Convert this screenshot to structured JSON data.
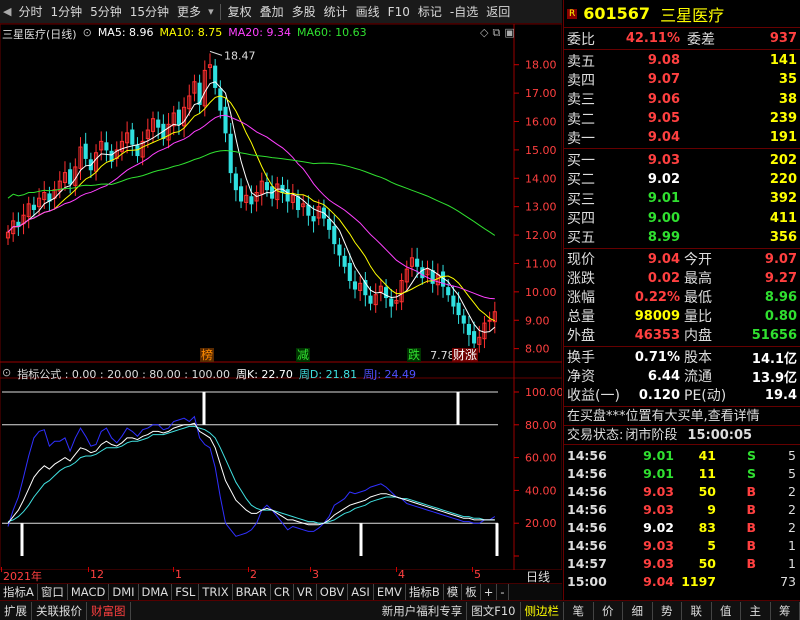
{
  "toolbar": {
    "items": [
      "分时",
      "1分钟",
      "5分钟",
      "15分钟",
      "更多",
      "复权",
      "叠加",
      "多股",
      "统计",
      "画线",
      "F10",
      "标记",
      "-自选",
      "返回"
    ]
  },
  "chart": {
    "stock_title": "三星医疗(日线)",
    "ma_labels": [
      {
        "text": "MA5: 8.96",
        "color": "#ffffff"
      },
      {
        "text": "MA10: 8.75",
        "color": "#ffff00"
      },
      {
        "text": "MA20: 9.34",
        "color": "#ff40ff"
      },
      {
        "text": "MA60: 10.63",
        "color": "#30e030"
      }
    ],
    "high_marker": "18.47",
    "low_marker": "7.78",
    "events": [
      {
        "text": "榜",
        "color": "#ff8c00",
        "bg": "#5a2a00"
      },
      {
        "text": "减",
        "color": "#30e030",
        "bg": "#003300"
      },
      {
        "text": "跌",
        "color": "#30e030",
        "bg": "#003300"
      },
      {
        "text": "财涨",
        "color": "#ffffff",
        "bg": "#700000"
      }
    ],
    "indicator_legend": "指标公式 : 0.00 : 20.00 : 80.00 : 100.00",
    "indicator_lines": [
      {
        "text": "周K: 22.70",
        "color": "#ffffff"
      },
      {
        "text": "周D: 21.81",
        "color": "#40e0e0"
      },
      {
        "text": "周J: 24.49",
        "color": "#3030ff"
      }
    ],
    "x_labels": [
      "2021年",
      "12",
      "1",
      "2",
      "3",
      "4",
      "5"
    ],
    "x_unit": "日线"
  },
  "chart_data": {
    "type": "candlestick",
    "y_axis_labels": [
      18.0,
      17.0,
      16.0,
      15.0,
      14.0,
      13.0,
      12.0,
      11.0,
      10.0,
      9.0,
      8.0
    ],
    "indicator_axis_labels": [
      100.0,
      80.0,
      60.0,
      40.0,
      20.0,
      0.0
    ],
    "ylim": [
      7.6,
      18.8
    ],
    "high": 18.47,
    "low": 7.78,
    "closes": [
      12.1,
      12.5,
      12.3,
      12.7,
      13.1,
      12.9,
      13.3,
      13.5,
      13.2,
      13.6,
      13.9,
      14.2,
      13.8,
      14.4,
      15.1,
      14.7,
      14.3,
      14.9,
      15.3,
      15.0,
      14.6,
      15.0,
      15.3,
      15.6,
      15.2,
      14.8,
      15.3,
      15.7,
      16.1,
      15.8,
      15.4,
      15.9,
      16.3,
      15.9,
      16.5,
      16.9,
      17.4,
      16.6,
      17.8,
      18.0,
      17.2,
      16.4,
      15.6,
      14.2,
      13.6,
      13.2,
      13.4,
      13.1,
      13.5,
      13.9,
      13.6,
      13.3,
      13.8,
      13.5,
      13.2,
      13.4,
      12.9,
      13.1,
      12.7,
      12.5,
      13.0,
      12.6,
      12.2,
      11.7,
      11.3,
      10.9,
      10.4,
      10.1,
      10.3,
      9.9,
      9.6,
      9.9,
      10.2,
      9.8,
      9.5,
      9.7,
      10.4,
      10.8,
      11.2,
      10.9,
      10.5,
      10.8,
      10.3,
      10.6,
      10.2,
      9.9,
      9.5,
      9.2,
      8.9,
      8.5,
      8.2,
      8.4,
      8.9,
      9.0,
      9.3
    ],
    "indicator_k": [
      20,
      24,
      28,
      34,
      41,
      48,
      52,
      55,
      53,
      56,
      58,
      60,
      58,
      62,
      66,
      65,
      63,
      64,
      68,
      70,
      68,
      67,
      69,
      72,
      72,
      71,
      73,
      74,
      76,
      76,
      75,
      76,
      78,
      79,
      80,
      80,
      81,
      76,
      74,
      72,
      66,
      56,
      46,
      40,
      34,
      31,
      28,
      26,
      26,
      28,
      29,
      28,
      26,
      24,
      22,
      22,
      21,
      20,
      19,
      19,
      19,
      20,
      22,
      25,
      27,
      29,
      31,
      32,
      33,
      34,
      36,
      37,
      38,
      38,
      37,
      36,
      35,
      34,
      33,
      32,
      31,
      30,
      29,
      28,
      27,
      26,
      25,
      24,
      23,
      23,
      22,
      22,
      22,
      22,
      22
    ],
    "indicator_d": [
      21,
      22,
      24,
      27,
      31,
      36,
      40,
      44,
      46,
      49,
      52,
      54,
      55,
      57,
      60,
      61,
      61,
      62,
      64,
      66,
      66,
      66,
      67,
      69,
      70,
      70,
      71,
      72,
      74,
      74,
      74,
      75,
      76,
      77,
      78,
      79,
      79,
      78,
      77,
      75,
      72,
      66,
      59,
      52,
      45,
      40,
      35,
      31,
      29,
      28,
      28,
      28,
      27,
      26,
      25,
      24,
      23,
      22,
      21,
      21,
      20,
      20,
      21,
      22,
      24,
      26,
      27,
      29,
      30,
      31,
      33,
      34,
      35,
      36,
      36,
      36,
      35,
      35,
      34,
      33,
      32,
      31,
      30,
      29,
      28,
      27,
      26,
      25,
      24,
      24,
      23,
      23,
      22,
      22,
      22
    ],
    "indicator_j": [
      18,
      28,
      36,
      48,
      61,
      72,
      76,
      77,
      67,
      70,
      70,
      72,
      64,
      72,
      78,
      73,
      67,
      68,
      76,
      78,
      72,
      69,
      73,
      78,
      76,
      73,
      77,
      78,
      80,
      80,
      77,
      78,
      82,
      83,
      84,
      82,
      85,
      72,
      68,
      66,
      54,
      36,
      20,
      16,
      12,
      13,
      14,
      16,
      20,
      28,
      31,
      28,
      24,
      20,
      16,
      18,
      17,
      16,
      15,
      15,
      17,
      20,
      24,
      31,
      33,
      35,
      39,
      38,
      39,
      40,
      42,
      43,
      44,
      42,
      39,
      36,
      35,
      32,
      31,
      30,
      29,
      28,
      27,
      26,
      25,
      24,
      23,
      22,
      21,
      21,
      20,
      20,
      22,
      22,
      24
    ]
  },
  "bottom": {
    "tabs1": [
      "指标A",
      "窗口",
      "MACD",
      "DMI",
      "DMA",
      "FSL",
      "TRIX",
      "BRAR",
      "CR",
      "VR",
      "OBV",
      "ASI",
      "EMV",
      "指标B",
      "模",
      "板",
      "+",
      "-"
    ],
    "tabs2_left": [
      "扩展",
      "关联报价",
      "财富图"
    ],
    "tabs2_mid": [
      "新用户福利专享",
      "图文F10",
      "侧边栏"
    ],
    "tabs2_right": [
      "笔",
      "价",
      "细",
      "势",
      "联",
      "值",
      "主",
      "筹"
    ]
  },
  "panel": {
    "badge": "R",
    "code": "601567",
    "name": "三星医疗",
    "wei_bi_label": "委比",
    "wei_bi": "42.11%",
    "wei_cha_label": "委差",
    "wei_cha": "937",
    "sells": [
      {
        "label": "卖五",
        "price": "9.08",
        "vol": "141"
      },
      {
        "label": "卖四",
        "price": "9.07",
        "vol": "35"
      },
      {
        "label": "卖三",
        "price": "9.06",
        "vol": "38"
      },
      {
        "label": "卖二",
        "price": "9.05",
        "vol": "239"
      },
      {
        "label": "卖一",
        "price": "9.04",
        "vol": "191"
      }
    ],
    "buys": [
      {
        "label": "买一",
        "price": "9.03",
        "vol": "202",
        "cls": "red"
      },
      {
        "label": "买二",
        "price": "9.02",
        "vol": "220",
        "cls": "wht"
      },
      {
        "label": "买三",
        "price": "9.01",
        "vol": "392",
        "cls": "grn"
      },
      {
        "label": "买四",
        "price": "9.00",
        "vol": "411",
        "cls": "grn"
      },
      {
        "label": "买五",
        "price": "8.99",
        "vol": "356",
        "cls": "grn"
      }
    ],
    "quote1": [
      {
        "l1": "现价",
        "v1": "9.04",
        "c1": "red",
        "l2": "今开",
        "v2": "9.07",
        "c2": "red"
      },
      {
        "l1": "涨跌",
        "v1": "0.02",
        "c1": "red",
        "l2": "最高",
        "v2": "9.27",
        "c2": "red"
      },
      {
        "l1": "涨幅",
        "v1": "0.22%",
        "c1": "red",
        "l2": "最低",
        "v2": "8.96",
        "c2": "grn"
      },
      {
        "l1": "总量",
        "v1": "98009",
        "c1": "yel",
        "l2": "量比",
        "v2": "0.80",
        "c2": "grn"
      },
      {
        "l1": "外盘",
        "v1": "46353",
        "c1": "red",
        "l2": "内盘",
        "v2": "51656",
        "c2": "grn"
      }
    ],
    "quote2": [
      {
        "l1": "换手",
        "v1": "0.71%",
        "l2": "股本",
        "v2": "14.1亿"
      },
      {
        "l1": "净资",
        "v1": "6.44",
        "l2": "流通",
        "v2": "13.9亿"
      },
      {
        "l1": "收益(一)",
        "v1": "0.120",
        "l2": "PE(动)",
        "v2": "19.4"
      }
    ],
    "notice": "在买盘***位置有大买单,查看详情",
    "status_label": "交易状态:",
    "status_value": "闭市阶段",
    "status_time": "15:00:05",
    "trades": [
      {
        "t": "14:56",
        "p": "9.01",
        "pc": "grn",
        "v": "41",
        "f": "S",
        "fc": "grn",
        "n": "5"
      },
      {
        "t": "14:56",
        "p": "9.01",
        "pc": "grn",
        "v": "11",
        "f": "S",
        "fc": "grn",
        "n": "5"
      },
      {
        "t": "14:56",
        "p": "9.03",
        "pc": "red",
        "v": "50",
        "f": "B",
        "fc": "red",
        "n": "2"
      },
      {
        "t": "14:56",
        "p": "9.03",
        "pc": "red",
        "v": "9",
        "f": "B",
        "fc": "red",
        "n": "2"
      },
      {
        "t": "14:56",
        "p": "9.02",
        "pc": "wht",
        "v": "83",
        "f": "B",
        "fc": "red",
        "n": "2"
      },
      {
        "t": "14:56",
        "p": "9.03",
        "pc": "red",
        "v": "5",
        "f": "B",
        "fc": "red",
        "n": "1"
      },
      {
        "t": "14:57",
        "p": "9.03",
        "pc": "red",
        "v": "50",
        "f": "B",
        "fc": "red",
        "n": "1"
      },
      {
        "t": "15:00",
        "p": "9.04",
        "pc": "red",
        "v": "1197",
        "f": "",
        "fc": "red",
        "n": "73",
        "vcls": "mag"
      }
    ]
  }
}
